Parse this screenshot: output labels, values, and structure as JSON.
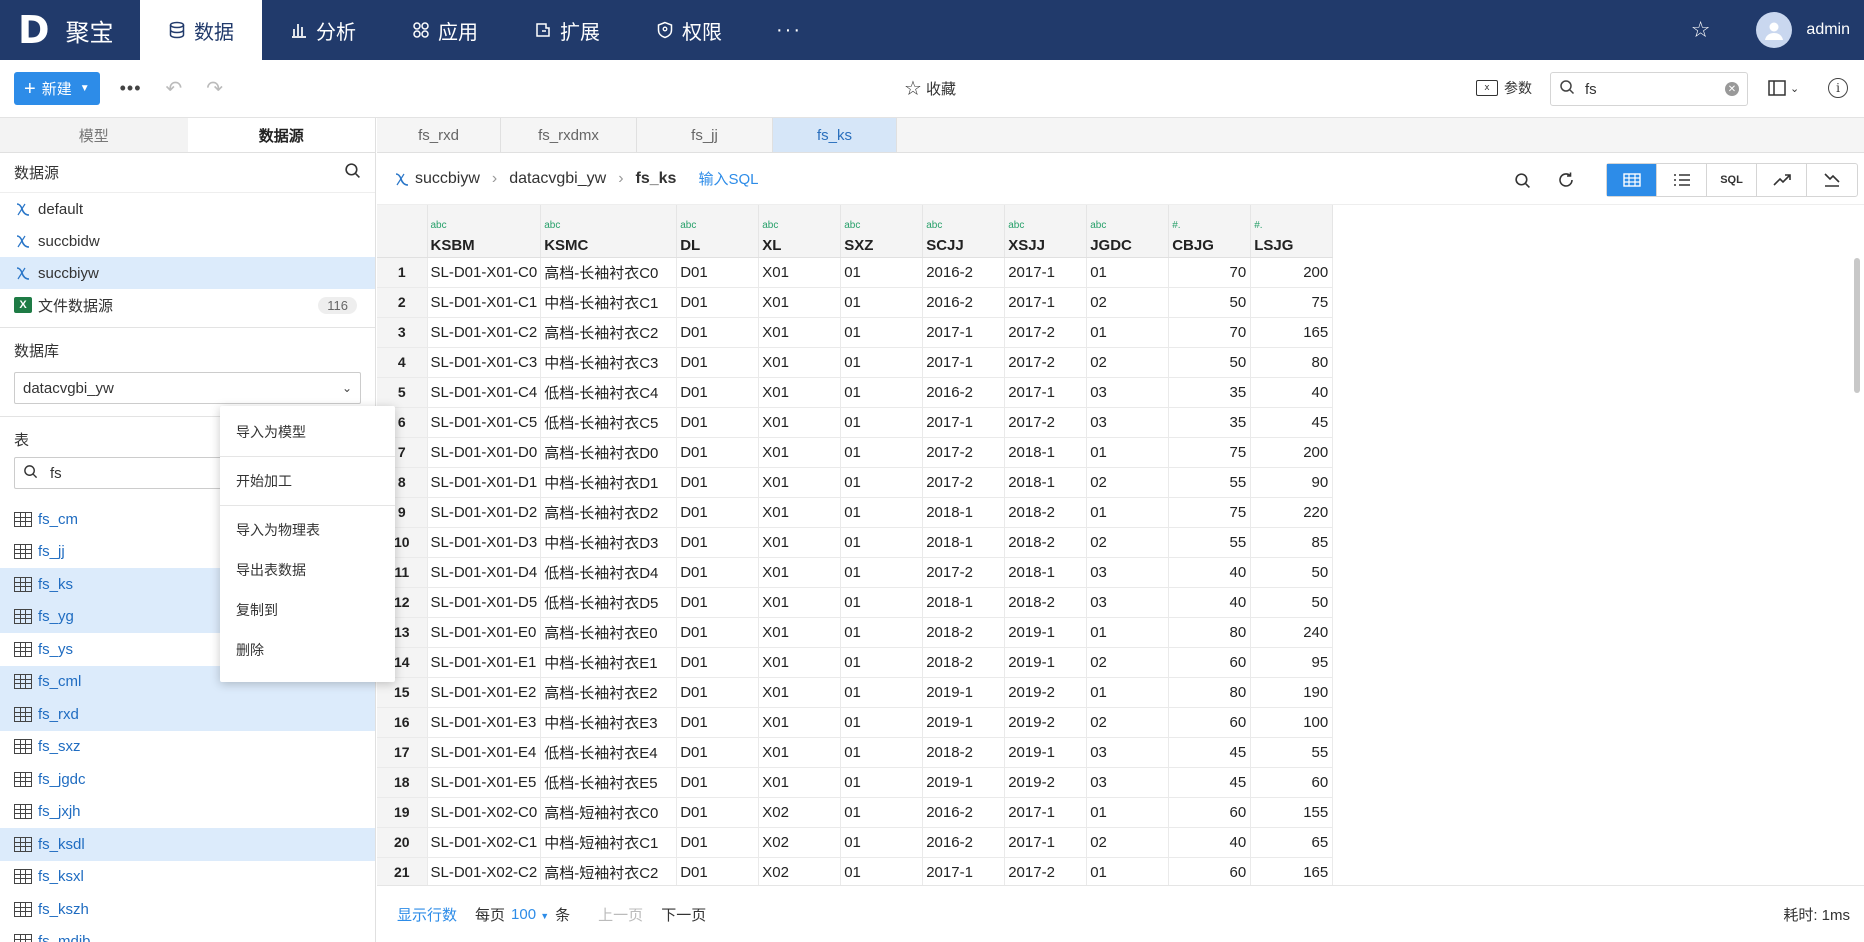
{
  "app": {
    "logo": "D",
    "name": "聚宝"
  },
  "nav": [
    {
      "label": "数据",
      "icon": "database-icon",
      "active": true
    },
    {
      "label": "分析",
      "icon": "bar-chart-icon"
    },
    {
      "label": "应用",
      "icon": "apps-icon"
    },
    {
      "label": "扩展",
      "icon": "extension-icon"
    },
    {
      "label": "权限",
      "icon": "shield-icon"
    }
  ],
  "nav_more": "···",
  "user": {
    "name": "admin"
  },
  "toolbar": {
    "new_label": "新建",
    "more": "•••",
    "favorite_label": "收藏",
    "params_label": "参数",
    "search_value": "fs"
  },
  "left_tabs": [
    "模型",
    "数据源"
  ],
  "datasource_title": "数据源",
  "datasources": [
    {
      "name": "default"
    },
    {
      "name": "succbidw"
    },
    {
      "name": "succbiyw",
      "selected": true
    },
    {
      "name": "文件数据源",
      "count": "116",
      "type": "excel"
    }
  ],
  "database_title": "数据库",
  "database_value": "datacvgbi_yw",
  "table_title": "表",
  "table_search": "fs",
  "tables": [
    {
      "name": "fs_cm"
    },
    {
      "name": "fs_jj"
    },
    {
      "name": "fs_ks",
      "selected": true
    },
    {
      "name": "fs_yg",
      "selected": true
    },
    {
      "name": "fs_ys"
    },
    {
      "name": "fs_cml",
      "selected": true
    },
    {
      "name": "fs_rxd",
      "selected": true
    },
    {
      "name": "fs_sxz"
    },
    {
      "name": "fs_jgdc"
    },
    {
      "name": "fs_jxjh"
    },
    {
      "name": "fs_ksdl",
      "selected": true
    },
    {
      "name": "fs_ksxl"
    },
    {
      "name": "fs_kszh"
    },
    {
      "name": "fs_mdjb"
    }
  ],
  "context_menu": [
    "导入为模型",
    "开始加工",
    "导入为物理表",
    "导出表数据",
    "复制到",
    "删除"
  ],
  "file_tabs": [
    {
      "label": "fs_rxd"
    },
    {
      "label": "fs_rxdmx"
    },
    {
      "label": "fs_jj"
    },
    {
      "label": "fs_ks",
      "active": true
    }
  ],
  "breadcrumb": {
    "datasource": "succbiyw",
    "database": "datacvgbi_yw",
    "table": "fs_ks",
    "sql_link": "输入SQL"
  },
  "view_modes": {
    "sql": "SQL"
  },
  "grid": {
    "columns": [
      {
        "type": "abc",
        "name": "KSBM"
      },
      {
        "type": "abc",
        "name": "KSMC"
      },
      {
        "type": "abc",
        "name": "DL"
      },
      {
        "type": "abc",
        "name": "XL"
      },
      {
        "type": "abc",
        "name": "SXZ"
      },
      {
        "type": "abc",
        "name": "SCJJ"
      },
      {
        "type": "abc",
        "name": "XSJJ"
      },
      {
        "type": "abc",
        "name": "JGDC"
      },
      {
        "type": "#.",
        "name": "CBJG"
      },
      {
        "type": "#.",
        "name": "LSJG"
      }
    ],
    "rows": [
      [
        "1",
        "SL-D01-X01-C0",
        "高档-长袖衬衣C0",
        "D01",
        "X01",
        "01",
        "2016-2",
        "2017-1",
        "01",
        "70",
        "200"
      ],
      [
        "2",
        "SL-D01-X01-C1",
        "中档-长袖衬衣C1",
        "D01",
        "X01",
        "01",
        "2016-2",
        "2017-1",
        "02",
        "50",
        "75"
      ],
      [
        "3",
        "SL-D01-X01-C2",
        "高档-长袖衬衣C2",
        "D01",
        "X01",
        "01",
        "2017-1",
        "2017-2",
        "01",
        "70",
        "165"
      ],
      [
        "4",
        "SL-D01-X01-C3",
        "中档-长袖衬衣C3",
        "D01",
        "X01",
        "01",
        "2017-1",
        "2017-2",
        "02",
        "50",
        "80"
      ],
      [
        "5",
        "SL-D01-X01-C4",
        "低档-长袖衬衣C4",
        "D01",
        "X01",
        "01",
        "2016-2",
        "2017-1",
        "03",
        "35",
        "40"
      ],
      [
        "6",
        "SL-D01-X01-C5",
        "低档-长袖衬衣C5",
        "D01",
        "X01",
        "01",
        "2017-1",
        "2017-2",
        "03",
        "35",
        "45"
      ],
      [
        "7",
        "SL-D01-X01-D0",
        "高档-长袖衬衣D0",
        "D01",
        "X01",
        "01",
        "2017-2",
        "2018-1",
        "01",
        "75",
        "200"
      ],
      [
        "8",
        "SL-D01-X01-D1",
        "中档-长袖衬衣D1",
        "D01",
        "X01",
        "01",
        "2017-2",
        "2018-1",
        "02",
        "55",
        "90"
      ],
      [
        "9",
        "SL-D01-X01-D2",
        "高档-长袖衬衣D2",
        "D01",
        "X01",
        "01",
        "2018-1",
        "2018-2",
        "01",
        "75",
        "220"
      ],
      [
        "10",
        "SL-D01-X01-D3",
        "中档-长袖衬衣D3",
        "D01",
        "X01",
        "01",
        "2018-1",
        "2018-2",
        "02",
        "55",
        "85"
      ],
      [
        "11",
        "SL-D01-X01-D4",
        "低档-长袖衬衣D4",
        "D01",
        "X01",
        "01",
        "2017-2",
        "2018-1",
        "03",
        "40",
        "50"
      ],
      [
        "12",
        "SL-D01-X01-D5",
        "低档-长袖衬衣D5",
        "D01",
        "X01",
        "01",
        "2018-1",
        "2018-2",
        "03",
        "40",
        "50"
      ],
      [
        "13",
        "SL-D01-X01-E0",
        "高档-长袖衬衣E0",
        "D01",
        "X01",
        "01",
        "2018-2",
        "2019-1",
        "01",
        "80",
        "240"
      ],
      [
        "14",
        "SL-D01-X01-E1",
        "中档-长袖衬衣E1",
        "D01",
        "X01",
        "01",
        "2018-2",
        "2019-1",
        "02",
        "60",
        "95"
      ],
      [
        "15",
        "SL-D01-X01-E2",
        "高档-长袖衬衣E2",
        "D01",
        "X01",
        "01",
        "2019-1",
        "2019-2",
        "01",
        "80",
        "190"
      ],
      [
        "16",
        "SL-D01-X01-E3",
        "中档-长袖衬衣E3",
        "D01",
        "X01",
        "01",
        "2019-1",
        "2019-2",
        "02",
        "60",
        "100"
      ],
      [
        "17",
        "SL-D01-X01-E4",
        "低档-长袖衬衣E4",
        "D01",
        "X01",
        "01",
        "2018-2",
        "2019-1",
        "03",
        "45",
        "55"
      ],
      [
        "18",
        "SL-D01-X01-E5",
        "低档-长袖衬衣E5",
        "D01",
        "X01",
        "01",
        "2019-1",
        "2019-2",
        "03",
        "45",
        "60"
      ],
      [
        "19",
        "SL-D01-X02-C0",
        "高档-短袖衬衣C0",
        "D01",
        "X02",
        "01",
        "2016-2",
        "2017-1",
        "01",
        "60",
        "155"
      ],
      [
        "20",
        "SL-D01-X02-C1",
        "中档-短袖衬衣C1",
        "D01",
        "X02",
        "01",
        "2016-2",
        "2017-1",
        "02",
        "40",
        "65"
      ],
      [
        "21",
        "SL-D01-X02-C2",
        "高档-短袖衬衣C2",
        "D01",
        "X02",
        "01",
        "2017-1",
        "2017-2",
        "01",
        "60",
        "165"
      ]
    ]
  },
  "footer": {
    "show_rows": "显示行数",
    "per_page_prefix": "每页",
    "per_page_value": "100",
    "per_page_suffix": "条",
    "prev": "上一页",
    "next": "下一页",
    "timing": "耗时: 1ms"
  },
  "colors": {
    "nav_bg": "#213a6b",
    "accent": "#2d8ce8",
    "selected_row": "#dcebfb"
  }
}
